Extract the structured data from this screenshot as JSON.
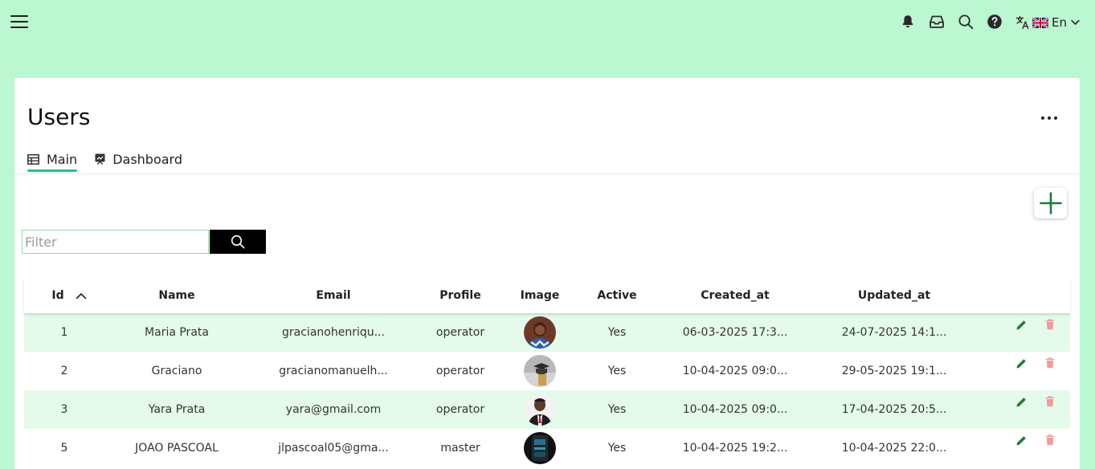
{
  "header": {
    "language_code": "En",
    "icons": [
      "menu-icon",
      "bell-icon",
      "inbox-icon",
      "search-icon",
      "help-icon",
      "translate-icon",
      "uk-flag-icon",
      "chevron-down-icon"
    ]
  },
  "page": {
    "title": "Users",
    "tabs": [
      {
        "label": "Main",
        "icon": "table-icon",
        "active": true
      },
      {
        "label": "Dashboard",
        "icon": "dashboard-icon",
        "active": false
      }
    ]
  },
  "filter": {
    "placeholder": "Filter",
    "value": ""
  },
  "table": {
    "columns": [
      "Id",
      "Name",
      "Email",
      "Profile",
      "Image",
      "Active",
      "Created_at",
      "Updated_at"
    ],
    "sort": {
      "column": "Id",
      "direction": "ascending"
    },
    "rows": [
      {
        "id": "1",
        "name": "Maria Prata",
        "email": "gracianohenriqu...",
        "profile": "operator",
        "active": "Yes",
        "created_at": "06-03-2025 17:3...",
        "updated_at": "24-07-2025 14:1..."
      },
      {
        "id": "2",
        "name": "Graciano",
        "email": "gracianomanuelh...",
        "profile": "operator",
        "active": "Yes",
        "created_at": "10-04-2025 09:0...",
        "updated_at": "29-05-2025 19:1..."
      },
      {
        "id": "3",
        "name": "Yara Prata",
        "email": "yara@gmail.com",
        "profile": "operator",
        "active": "Yes",
        "created_at": "10-04-2025 09:0...",
        "updated_at": "17-04-2025 20:5..."
      },
      {
        "id": "5",
        "name": "JOAO PASCOAL",
        "email": "jlpascoal05@gma...",
        "profile": "master",
        "active": "Yes",
        "created_at": "10-04-2025 19:2...",
        "updated_at": "10-04-2025 22:0..."
      }
    ]
  },
  "colors": {
    "background": "#bbf7d0",
    "accent": "#22c08f",
    "row_alt": "#e4fbeb",
    "edit": "#1f7a3a",
    "delete": "#f19a9a"
  }
}
